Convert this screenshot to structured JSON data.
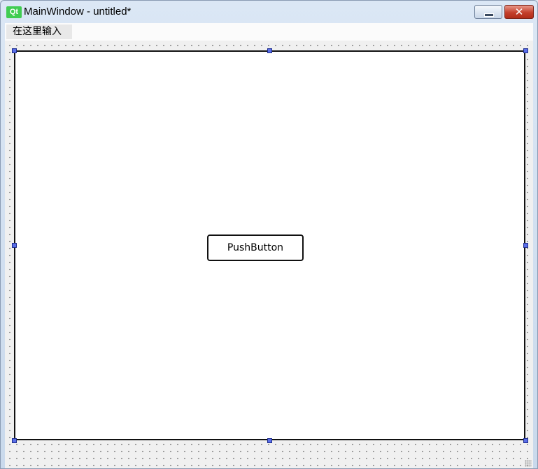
{
  "window": {
    "title": "MainWindow - untitled*",
    "logo_text": "Qt",
    "close_glyph": "✕"
  },
  "menubar": {
    "placeholder_entry": "在这里输入"
  },
  "form": {
    "push_button_label": "PushButton"
  },
  "colors": {
    "qt_green": "#41cd52",
    "selection_handle": "#5a6ee8",
    "close_button": "#c4402c"
  },
  "icons": [
    "qt-logo-icon",
    "minimize-icon",
    "close-icon",
    "resize-grip-icon"
  ]
}
